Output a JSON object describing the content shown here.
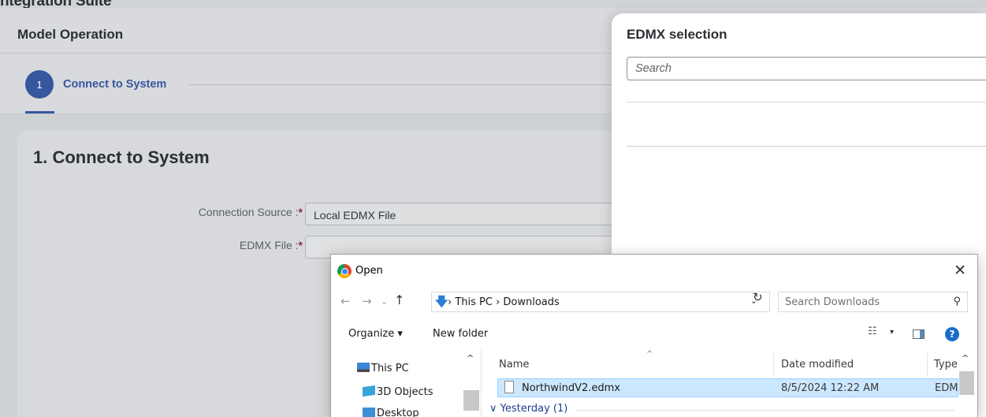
{
  "app": {
    "title": "ntegration Suite"
  },
  "operation": {
    "title": "Model Operation"
  },
  "wizard": {
    "step_number": "1",
    "step_label": "Connect to System"
  },
  "form": {
    "section_title": "1. Connect to System",
    "connection_source_label": "Connection Source :",
    "connection_source_value": "Local EDMX File",
    "edmx_file_label": "EDMX File :",
    "edmx_file_value": "",
    "required_mark": "*"
  },
  "edmx_panel": {
    "title": "EDMX selection",
    "search_placeholder": "Search"
  },
  "dialog": {
    "title": "Open",
    "close": "✕",
    "nav": {
      "back": "←",
      "forward": "→",
      "dropdown": "⌄",
      "up": "↑"
    },
    "address": {
      "arrow": "🡇",
      "path": "› This PC › Downloads",
      "chevron": "⌄",
      "refresh": "↻"
    },
    "search": {
      "placeholder": "Search Downloads",
      "icon": "⚲"
    },
    "toolbar": {
      "organize": "Organize ▾",
      "new_folder": "New folder",
      "view_icon": "☷",
      "view_drop": "▾",
      "help": "?"
    },
    "nav_pane": {
      "items": [
        {
          "label": "This PC",
          "icon": "pc-icon"
        },
        {
          "label": "3D Objects",
          "icon": "cube-icon"
        },
        {
          "label": "Desktop",
          "icon": "desktop-icon"
        }
      ]
    },
    "columns": {
      "name": "Name",
      "date_modified": "Date modified",
      "type": "Type"
    },
    "files": [
      {
        "name": "NorthwindV2.edmx",
        "date_modified": "8/5/2024 12:22 AM",
        "type": "EDM"
      }
    ],
    "groups": [
      {
        "label": "∨ Yesterday (1)"
      }
    ],
    "scroll_up": "^",
    "sort_caret": "^"
  },
  "colors": {
    "accent": "#37579d",
    "selection": "#cce8ff",
    "help": "#1c6cc9"
  }
}
